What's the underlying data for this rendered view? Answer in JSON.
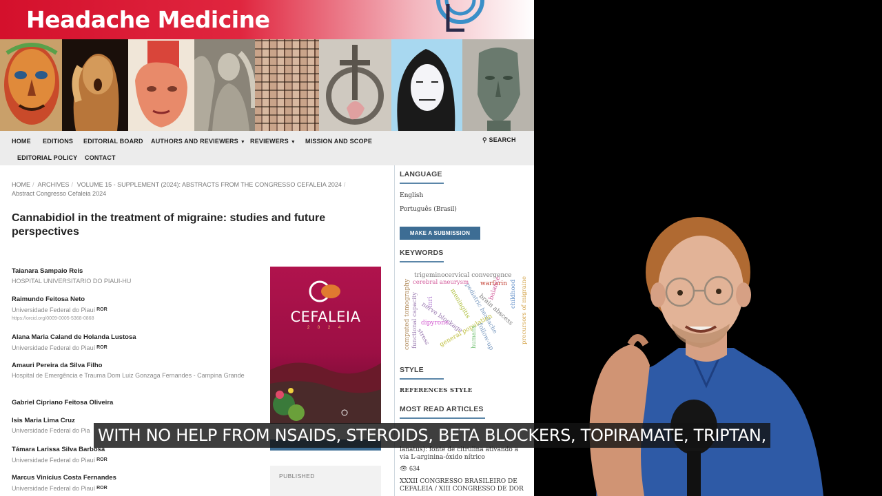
{
  "journal_title": "Headache Medicine",
  "nav": {
    "home": "HOME",
    "editions": "EDITIONS",
    "editorial_board": "EDITORIAL BOARD",
    "authors_reviewers": "AUTHORS AND REVIEWERS",
    "reviewers": "REVIEWERS",
    "mission": "MISSION AND SCOPE",
    "search": "SEARCH",
    "editorial_policy": "EDITORIAL POLICY",
    "contact": "CONTACT"
  },
  "breadcrumb": {
    "home": "HOME",
    "archives": "ARCHIVES",
    "volume": "VOLUME 15 - SUPPLEMENT (2024): ABSTRACTS FROM THE CONGRESSO CEFALEIA 2024",
    "section": "Abstract Congresso Cefaleia 2024"
  },
  "article_title": "Cannabidiol in the treatment of migraine: studies and future perspectives",
  "authors": [
    {
      "name": "Taianara Sampaio Reis",
      "affiliation": "HOSPITAL UNIVERSITARIO DO PIAUI-HU"
    },
    {
      "name": "Raimundo Feitosa Neto",
      "affiliation": "Universidade Federal do Piauí",
      "ror": "ROR",
      "orcid": "https://orcid.org/0009-0005-5368-0868"
    },
    {
      "name": "Alana Maria Caland de Holanda Lustosa",
      "affiliation": "Universidade Federal do Piauí",
      "ror": "ROR"
    },
    {
      "name": "Amauri Pereira da Silva Filho",
      "affiliation": "Hospital de Emergência e Trauma Dom Luiz Gonzaga Fernandes - Campina Grande"
    },
    {
      "name": "Gabriel Cipriano Feitosa Oliveira"
    },
    {
      "name": "Isis Maria Lima Cruz",
      "affiliation": "Universidade Federal do Pia"
    },
    {
      "name": "Támara Larissa Silva Barbosa",
      "affiliation": "Universidade Federal do Piauí",
      "ror": "ROR"
    },
    {
      "name": "Marcus Vinícius Costa Fernandes",
      "affiliation": "Universidade Federal do Piauí",
      "ror": "ROR"
    }
  ],
  "cover": {
    "title": "CEFALEIA",
    "year": "2 0 2 4"
  },
  "published_label": "PUBLISHED",
  "sidebar": {
    "language_heading": "LANGUAGE",
    "languages": [
      "English",
      "Português (Brasil)"
    ],
    "submit_label": "MAKE A SUBMISSION",
    "keywords_heading": "KEYWORDS",
    "keywords": [
      {
        "text": "trigeminocervical convergence",
        "color": "#777777"
      },
      {
        "text": "cerebral aneurysm",
        "color": "#d25a9a"
      },
      {
        "text": "warfarin",
        "color": "#c0392b"
      },
      {
        "text": "balance",
        "color": "#d25a9a"
      },
      {
        "text": "childhood",
        "color": "#5a8ac6"
      },
      {
        "text": "precursors of migraine",
        "color": "#d4a44a"
      },
      {
        "text": "computed tomography",
        "color": "#b08a5a"
      },
      {
        "text": "functional capacity",
        "color": "#9a7ab0"
      },
      {
        "text": "mri",
        "color": "#b07ad0"
      },
      {
        "text": "nerve blockage",
        "color": "#9a7ab0"
      },
      {
        "text": "meningitis",
        "color": "#b0c040"
      },
      {
        "text": "pediatric headache",
        "color": "#7a9ac0"
      },
      {
        "text": "brain abscess",
        "color": "#7a7a7a"
      },
      {
        "text": "dipyrone",
        "color": "#d25ad0"
      },
      {
        "text": "stress",
        "color": "#9a7ab0"
      },
      {
        "text": "general population",
        "color": "#c0c040"
      },
      {
        "text": "humans",
        "color": "#70c070"
      },
      {
        "text": "follow-up",
        "color": "#7a9ac0"
      }
    ],
    "style_heading": "STYLE",
    "references_style": "REFERENCES STYLE",
    "most_read_heading": "MOST READ ARTICLES",
    "most_read": [
      {
        "text": "lanatus): fonte de citrulina ativando a via L-arginina-óxido nítrico",
        "views": "634"
      },
      {
        "text": "XXXII CONGRESSO BRASILEIRO DE CEFALEIA / XIII CONGRESSO DE DOR"
      }
    ]
  },
  "caption": "WITH NO HELP FROM NSAIDS, STEROIDS, BETA BLOCKERS, TOPIRAMATE, TRIPTAN,"
}
